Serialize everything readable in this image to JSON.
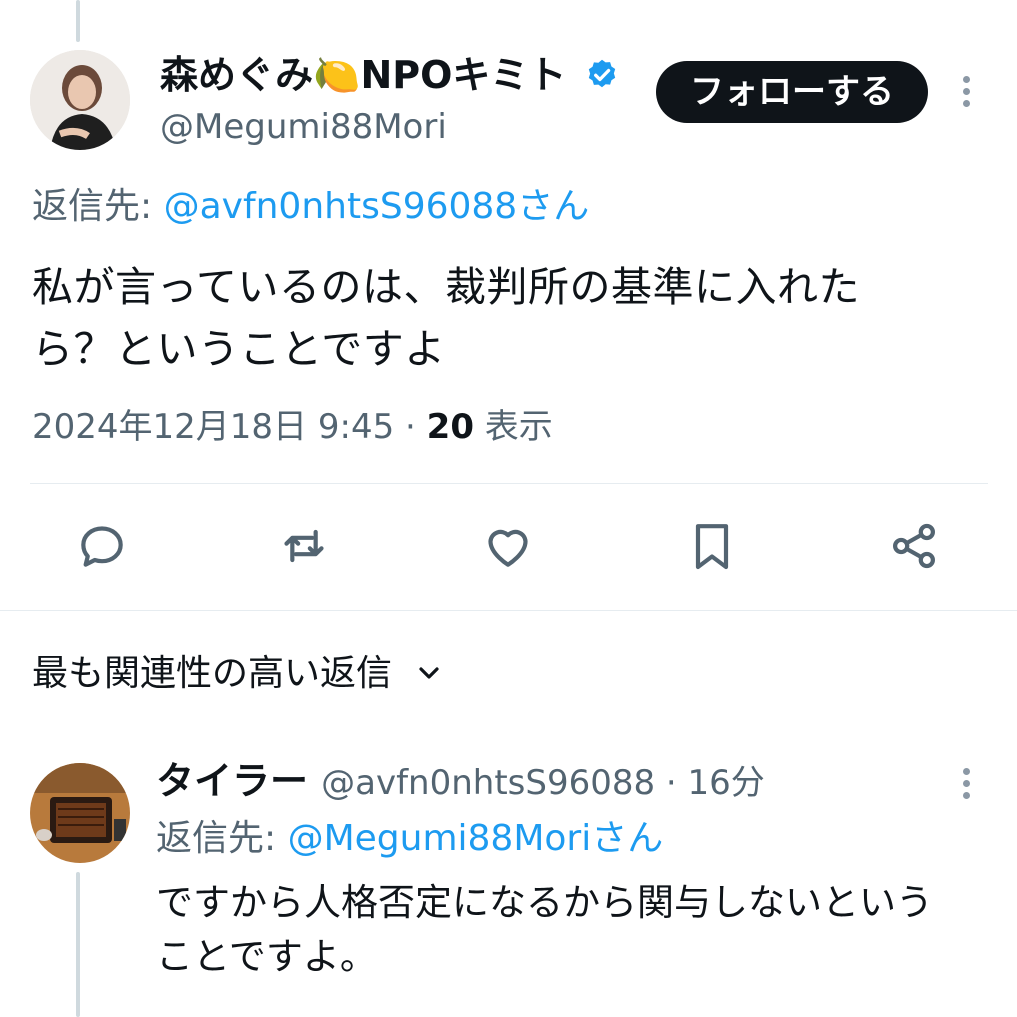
{
  "tweet": {
    "author_name": "森めぐみ🍋NPOキミト",
    "author_handle": "@Megumi88Mori",
    "follow_label": "フォローする",
    "reply_to_prefix": "返信先: ",
    "reply_to_handle": "@avfn0nhtsS96088さん",
    "text_line1": "私が言っているのは、裁判所の基準に入れた",
    "text_line2": "ら？ということですよ",
    "timestamp": "2024年12月18日 9:45",
    "separator": " · ",
    "views_count": "20",
    "views_label": " 表示",
    "verified_color": "#1d9bf0"
  },
  "sort": {
    "label": "最も関連性の高い返信"
  },
  "reply": {
    "author_name": "タイラー",
    "author_handle": "@avfn0nhtsS96088",
    "time": " · 16分",
    "reply_to_prefix": "返信先: ",
    "reply_to_handle": "@Megumi88Moriさん",
    "text_line1": "ですから人格否定になるから関与しないという",
    "text_line2": "ことですよ。"
  },
  "icons": {
    "actions": [
      "reply-icon",
      "retweet-icon",
      "like-icon",
      "bookmark-icon",
      "share-icon"
    ],
    "accent": "#1d9bf0",
    "icon_color": "#536471"
  }
}
